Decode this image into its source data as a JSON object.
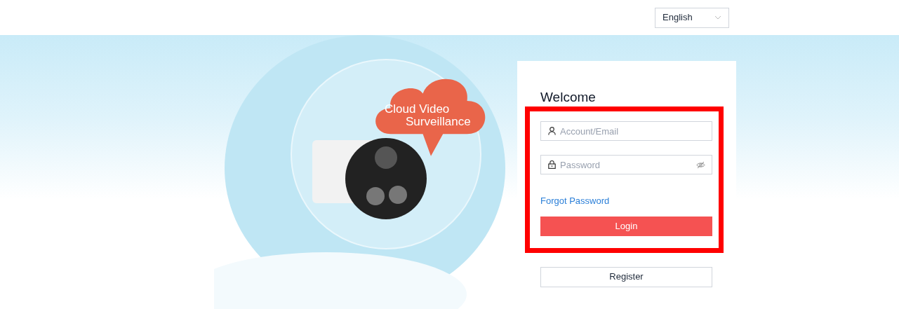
{
  "language_select": {
    "value": "English"
  },
  "banner": {
    "cloud_text": [
      "Cloud Video",
      "Surveillance"
    ]
  },
  "login_card": {
    "title": "Welcome",
    "fields": [
      {
        "kind": "account",
        "placeholder": "Account/Email"
      },
      {
        "kind": "password",
        "placeholder": "Password"
      }
    ],
    "forgot_link": "Forgot Password",
    "login_button": "Login",
    "register_button": "Register"
  }
}
